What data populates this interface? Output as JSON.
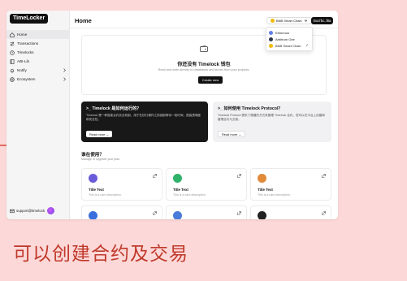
{
  "caption": "可以创建合约及交易",
  "sidebar": {
    "brand": "TimeLocker",
    "items": [
      {
        "label": "Home",
        "icon": "home-icon"
      },
      {
        "label": "Transactions",
        "icon": "transactions-icon"
      },
      {
        "label": "Timelocks",
        "icon": "clock-icon"
      },
      {
        "label": "ABI-Lib",
        "icon": "book-icon"
      },
      {
        "label": "Notify",
        "icon": "bell-icon"
      },
      {
        "label": "Ecosystem",
        "icon": "grid-icon"
      }
    ],
    "user_email": "support@timelock"
  },
  "header": {
    "title": "Home",
    "chain_selected": "BNB Smart Chain",
    "address": "0xa7bc..f8a"
  },
  "dropdown": {
    "options": [
      {
        "label": "Ethereum",
        "color": "#627eea"
      },
      {
        "label": "Arbitrum One",
        "color": "#2d374b"
      },
      {
        "label": "BNB Smart Chain",
        "color": "#f0b90b",
        "selected": true
      }
    ]
  },
  "empty_state": {
    "title": "你还没有 Timelock 钱包",
    "subtitle": "Read and write directly to databases and stores from your projects.",
    "button": "Create new"
  },
  "guides": [
    {
      "title": ">_ Timelock 是如何运行的？",
      "desc": "Timelock 是一种智能合约安全机制，用于在执行操作之前强制等待一段时间，提高透明度和安全性。",
      "button": "Read more →"
    },
    {
      "title": ">_ 如何使用 Timelock Protocol？",
      "desc": "Timelock Protocol 提供了便捷的方式来管理 Timelock 合约，您可以在平台上创建和管理合约与交易。",
      "button": "Read more →"
    }
  ],
  "protocols": {
    "title": "谁在使用？",
    "subtitle": "Manage or upgrade your plan.",
    "cards": [
      {
        "title": "Title Text",
        "desc": "This is a card description.",
        "logo_color": "#6a5cd8"
      },
      {
        "title": "Title Text",
        "desc": "This is a card description.",
        "logo_color": "#2fb26b"
      },
      {
        "title": "Title Text",
        "desc": "This is a card description.",
        "logo_color": "#e08a3a"
      }
    ]
  }
}
